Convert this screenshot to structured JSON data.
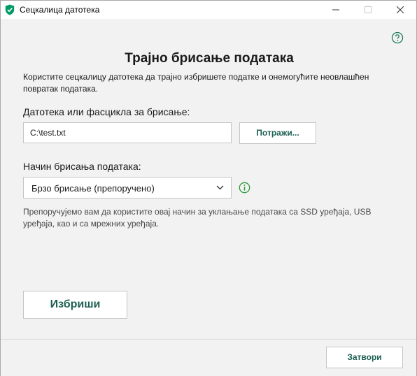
{
  "window": {
    "title": "Сецкалица датотека",
    "app_icon": "shield-check-icon",
    "controls": [
      "minimize-icon",
      "maximize-icon",
      "close-icon"
    ]
  },
  "help_icon": "question-circle-icon",
  "main": {
    "heading": "Трајно брисање података",
    "description": "Користите сецкалицу датотека да трајно избришете податке и онемогућите неовлашћен повратак података.",
    "path_label": "Датотека или фасцикла за брисање:",
    "path_value": "C:\\test.txt",
    "browse_label": "Потражи...",
    "method_label": "Начин брисања података:",
    "method_selected": "Брзо брисање (препоручено)",
    "info_icon": "info-circle-icon",
    "hint": "Препоручујемо вам да користите овај начин за уклањање података са SSD уређаја, USB уређаја, као и са мрежних уређаја.",
    "delete_label": "Избриши"
  },
  "footer": {
    "close_label": "Затвори"
  },
  "colors": {
    "accent": "#1b5e52",
    "brand_green": "#009a66",
    "background": "#f2f2f2"
  }
}
